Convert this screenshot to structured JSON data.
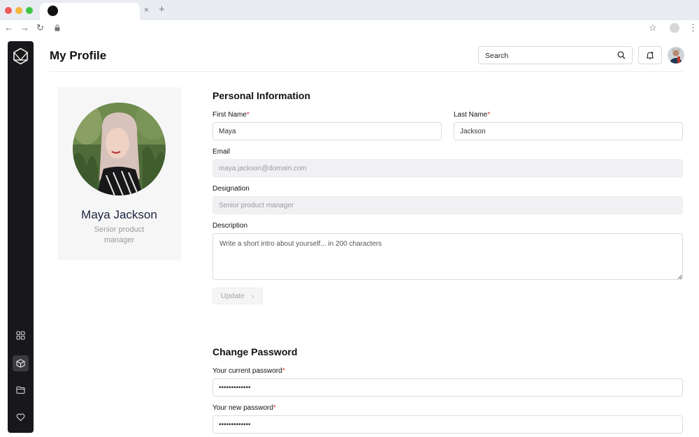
{
  "browser": {
    "traffic_lights": [
      "#ee5b57",
      "#f5b83a",
      "#3dc445"
    ],
    "tab_close": "×",
    "tab_new": "+",
    "back": "←",
    "forward": "→",
    "reload": "↻",
    "star": "☆",
    "menu": "⋮"
  },
  "sidebar": {
    "items": [
      {
        "name": "apps-grid-icon",
        "active": false
      },
      {
        "name": "cube-icon",
        "active": true
      },
      {
        "name": "folder-icon",
        "active": false
      },
      {
        "name": "heart-icon",
        "active": false
      }
    ]
  },
  "header": {
    "title": "My Profile",
    "search_placeholder": "Search"
  },
  "profile": {
    "name": "Maya Jackson",
    "role": "Senior product manager"
  },
  "personal": {
    "title": "Personal Information",
    "first_name_label": "First Name",
    "first_name_value": "Maya",
    "last_name_label": "Last Name",
    "last_name_value": "Jackson",
    "email_label": "Email",
    "email_value": "maya.jackson@domain.com",
    "designation_label": "Designation",
    "designation_value": "Senior product manager",
    "description_label": "Description",
    "description_placeholder": "Write a short intro about yourself... in 200 characters",
    "update_label": "Update",
    "update_chevron": "›",
    "required_mark": "*"
  },
  "password": {
    "title": "Change Password",
    "current_label": "Your current password",
    "current_value": "•••••••••••••",
    "new_label": "Your new password",
    "new_value": "•••••••••••••"
  }
}
